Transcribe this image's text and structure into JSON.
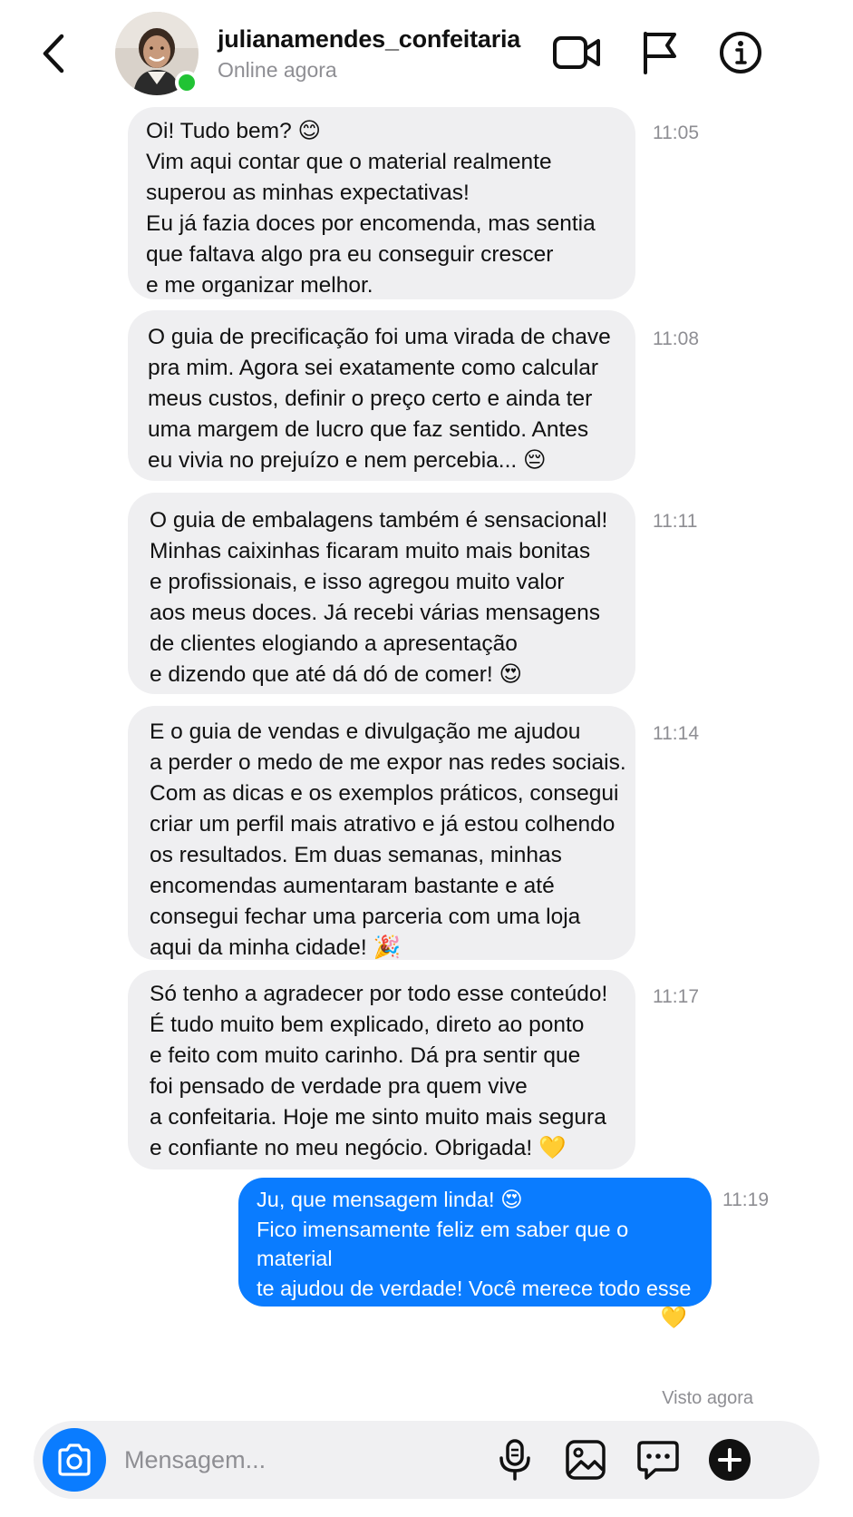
{
  "header": {
    "username": "julianamendes_confeitaria",
    "status": "Online agora",
    "icons": [
      "back-icon",
      "video-call-icon",
      "flag-icon",
      "info-icon"
    ]
  },
  "messages": [
    {
      "direction": "incoming",
      "text": "Oi! Tudo bem? 😊\nVim aqui contar que o material realmente\nsuperou as minhas expectativas!\nEu já fazia doces por encomenda, mas sentia\nque faltava algo pra eu conseguir crescer\ne me organizar melhor.",
      "time": "11:05"
    },
    {
      "direction": "incoming",
      "text": "O guia de precificação foi uma virada de chave\npra mim. Agora sei exatamente como calcular\nmeus custos, definir o preço certo e ainda ter\numa margem de lucro que faz sentido. Antes\neu vivia no prejuízo e nem percebia... 😔",
      "time": "11:08"
    },
    {
      "direction": "incoming",
      "text": "O guia de embalagens também é sensacional!\nMinhas caixinhas ficaram muito mais bonitas\ne profissionais, e isso agregou muito valor\naos meus doces. Já recebi várias mensagens\nde clientes elogiando a apresentação\ne dizendo que até dá dó de comer! 😍",
      "time": "11:11"
    },
    {
      "direction": "incoming",
      "text": "E o guia de vendas e divulgação me ajudou\na perder o medo de me expor nas redes sociais.\nCom as dicas e os exemplos práticos, consegui\ncriar um perfil mais atrativo e já estou colhendo\nos resultados. Em duas semanas, minhas\nencomendas aumentaram bastante e até\nconsegui fechar uma parceria com uma loja\naqui da minha cidade! 🎉",
      "time": "11:14"
    },
    {
      "direction": "incoming",
      "text": "Só tenho a agradecer por todo esse conteúdo!\nÉ tudo muito bem explicado, direto ao ponto\ne feito com muito carinho. Dá pra sentir que\nfoi pensado de verdade pra quem vive\na confeitaria. Hoje me sinto muito mais segura\ne confiante no meu negócio. Obrigada! 💛",
      "time": "11:17"
    },
    {
      "direction": "outgoing",
      "text": "Ju, que mensagem linda! 😍\nFico imensamente feliz em saber que o material\nte ajudou de verdade! Você merece todo esse\nsucesso! Continue contando com a gente! 💛",
      "time": "11:19"
    }
  ],
  "seen_label": "Visto agora",
  "composer": {
    "placeholder": "Mensagem...",
    "icons": [
      "camera-icon",
      "microphone-icon",
      "gallery-icon",
      "sticker-chat-icon",
      "plus-icon"
    ]
  },
  "colors": {
    "accent": "#0a7cff",
    "online": "#21c334",
    "incoming_bubble": "#efeff1",
    "muted_text": "#8e8e93"
  }
}
